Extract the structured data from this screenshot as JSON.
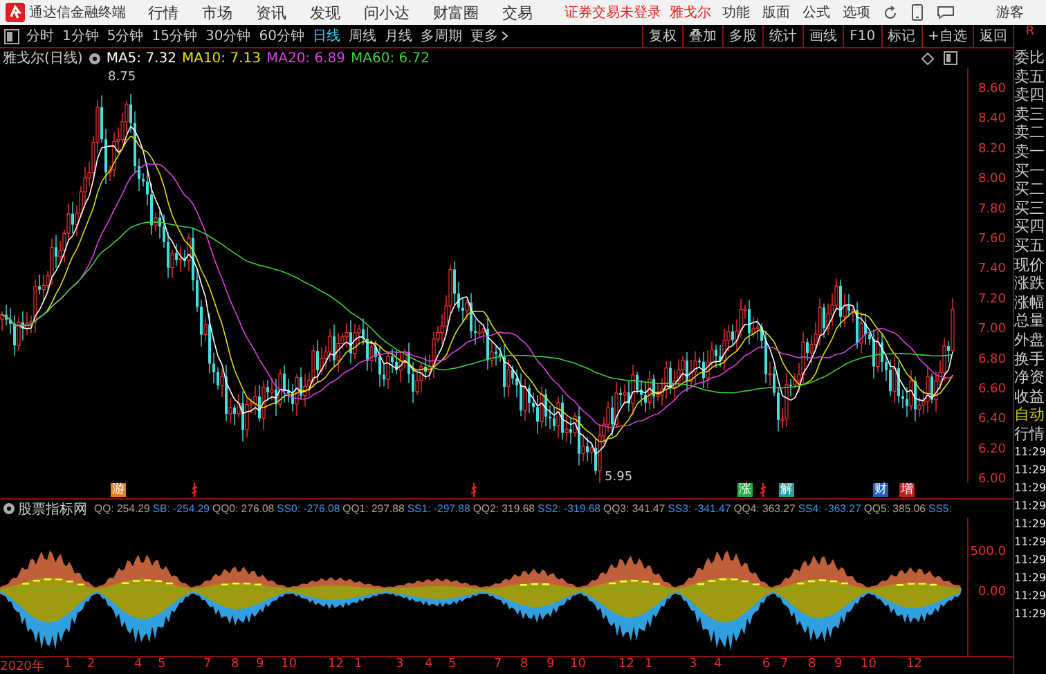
{
  "app": {
    "title": "通达信金融终端"
  },
  "menu": [
    "行情",
    "市场",
    "资讯",
    "发现",
    "问小达",
    "财富圈",
    "交易"
  ],
  "login_status": "证券交易未登录",
  "stock_name": "雅戈尔",
  "tools": [
    "功能",
    "版面",
    "公式",
    "选项"
  ],
  "user": "游客",
  "periods": [
    {
      "label": "分时",
      "selected": false
    },
    {
      "label": "1分钟",
      "selected": false
    },
    {
      "label": "5分钟",
      "selected": false
    },
    {
      "label": "15分钟",
      "selected": false
    },
    {
      "label": "30分钟",
      "selected": false
    },
    {
      "label": "60分钟",
      "selected": false
    },
    {
      "label": "日线",
      "selected": true
    },
    {
      "label": "周线",
      "selected": false
    },
    {
      "label": "月线",
      "selected": false
    },
    {
      "label": "多周期",
      "selected": false
    }
  ],
  "more": "更多",
  "actions": [
    "复权",
    "叠加",
    "多股",
    "统计",
    "画线",
    "F10",
    "标记",
    "+自选",
    "返回"
  ],
  "corner": "R",
  "legend": {
    "title": "雅戈尔(日线)",
    "ma": [
      {
        "label": "MA5: 7.32",
        "color": "#ffffff"
      },
      {
        "label": "MA10: 7.13",
        "color": "#e8e000"
      },
      {
        "label": "MA20: 6.89",
        "color": "#e040e0"
      },
      {
        "label": "MA60: 6.72",
        "color": "#40d040"
      }
    ]
  },
  "price_axis": [
    "8.60",
    "8.40",
    "8.20",
    "8.00",
    "7.80",
    "7.60",
    "7.40",
    "7.20",
    "7.00",
    "6.80",
    "6.60",
    "6.40",
    "6.20",
    "6.00"
  ],
  "price_marks": {
    "high": "8.75",
    "low": "5.95"
  },
  "events": [
    {
      "kind": "tag",
      "text": "游",
      "color": "#e08020"
    },
    {
      "kind": "icon",
      "color": "#e02020"
    },
    {
      "kind": "icon",
      "color": "#e02020"
    },
    {
      "kind": "tag",
      "text": "涨",
      "color": "#20b040"
    },
    {
      "kind": "icon",
      "color": "#e02020"
    },
    {
      "kind": "tag",
      "text": "解",
      "color": "#20a0a0"
    },
    {
      "kind": "tag",
      "text": "财",
      "color": "#2060c0"
    },
    {
      "kind": "tag",
      "text": "增",
      "color": "#c02020"
    }
  ],
  "quote_labels": [
    "委比",
    "卖五",
    "卖四",
    "卖三",
    "卖二",
    "卖一",
    "买一",
    "买二",
    "买三",
    "买四",
    "买五",
    "现价",
    "涨跌",
    "涨幅",
    "总量",
    "外盘",
    "换手",
    "净资",
    "收益"
  ],
  "quote_modes": [
    {
      "label": "自动",
      "selected": true
    },
    {
      "label": "行情",
      "selected": false
    }
  ],
  "ticks": [
    "11:29",
    "11:29",
    "11:29",
    "11:29",
    "11:29",
    "11:29",
    "11:29",
    "11:29",
    "11:29",
    "11:29"
  ],
  "indicator": {
    "title": "股票指标网",
    "values": [
      {
        "label": "QQ: 254.29",
        "color": "#b0a090"
      },
      {
        "label": "SB: -254.29",
        "color": "#4090e0"
      },
      {
        "label": "QQ0: 276.08",
        "color": "#b0a090"
      },
      {
        "label": "SS0: -276.08",
        "color": "#4090e0"
      },
      {
        "label": "QQ1: 297.88",
        "color": "#b0a090"
      },
      {
        "label": "SS1: -297.88",
        "color": "#4090e0"
      },
      {
        "label": "QQ2: 319.68",
        "color": "#b0a090"
      },
      {
        "label": "SS2: -319.68",
        "color": "#4090e0"
      },
      {
        "label": "QQ3: 341.47",
        "color": "#b0a090"
      },
      {
        "label": "SS3: -341.47",
        "color": "#4090e0"
      },
      {
        "label": "QQ4: 363.27",
        "color": "#b0a090"
      },
      {
        "label": "SS4: -363.27",
        "color": "#4090e0"
      },
      {
        "label": "QQ5: 385.06",
        "color": "#b0a090"
      },
      {
        "label": "SS5:",
        "color": "#4090e0"
      }
    ],
    "axis": [
      "500.0",
      "0.00"
    ]
  },
  "dates": [
    "2020年",
    "1",
    "2",
    "4",
    "5",
    "7",
    "8",
    "9",
    "10",
    "12",
    "1",
    "3",
    "4",
    "5",
    "7",
    "8",
    "9",
    "10",
    "12",
    "1",
    "3",
    "4",
    "6",
    "7",
    "8",
    "9",
    "10",
    "12"
  ]
}
